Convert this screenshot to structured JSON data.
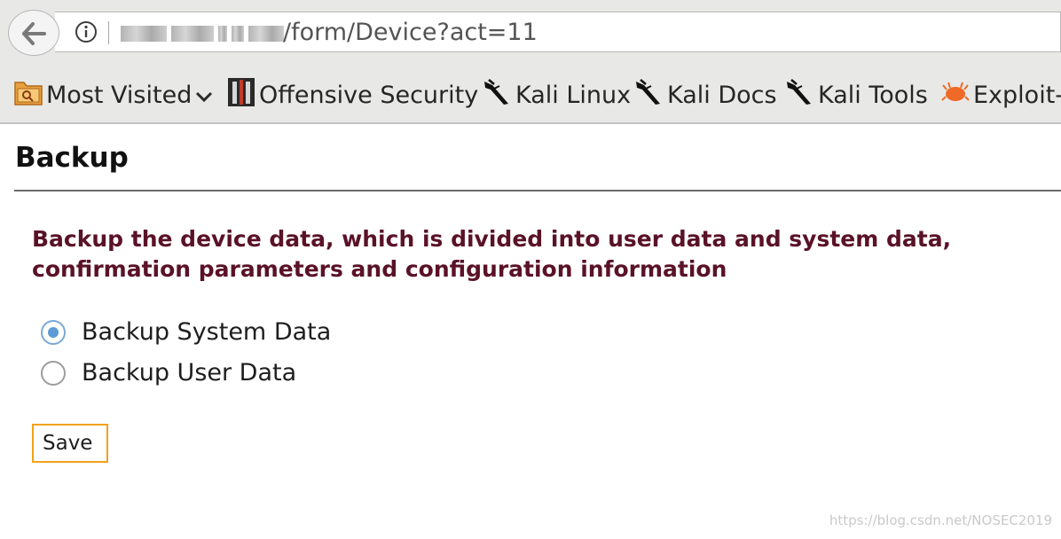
{
  "browser": {
    "url_path": "/form/Device?act=11",
    "bookmarks": [
      {
        "label": "Most Visited",
        "icon": "folder-icon"
      },
      {
        "label": "Offensive Security",
        "icon": "offsec-icon"
      },
      {
        "label": "Kali Linux",
        "icon": "kali-dragon-icon"
      },
      {
        "label": "Kali Docs",
        "icon": "kali-dragon-icon"
      },
      {
        "label": "Kali Tools",
        "icon": "kali-dragon-icon"
      },
      {
        "label": "Exploit-",
        "icon": "exploit-db-icon"
      }
    ]
  },
  "page": {
    "title": "Backup",
    "description_line1": "Backup the device data, which is divided into user data and system data,",
    "description_line2": "confirmation parameters and configuration information",
    "options": [
      {
        "label": "Backup System Data",
        "checked": true
      },
      {
        "label": "Backup User Data",
        "checked": false
      }
    ],
    "save_label": "Save"
  },
  "watermark": "https://blog.csdn.net/NOSEC2019",
  "colors": {
    "description_text": "#5a1228",
    "save_border": "#f0a21a",
    "radio_accent": "#5b9bd5"
  }
}
